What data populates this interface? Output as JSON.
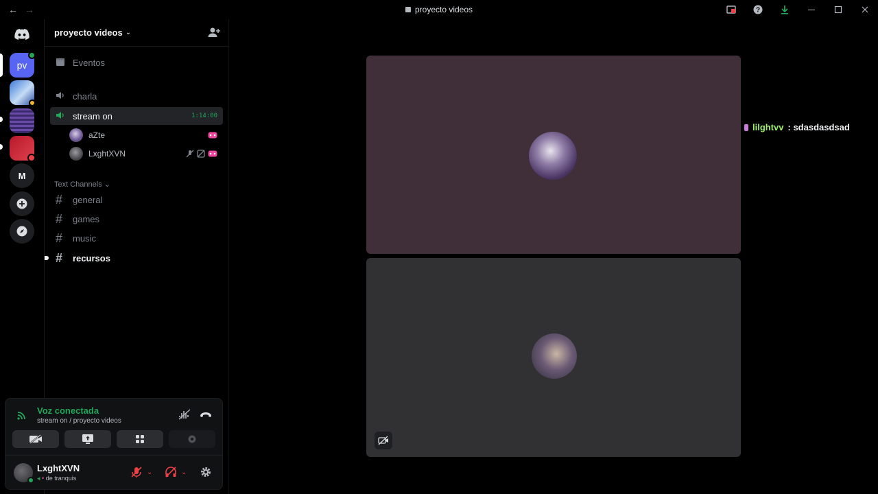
{
  "window": {
    "title": "proyecto videos"
  },
  "server": {
    "name": "proyecto videos",
    "rail_label_pv": "pv",
    "rail_label_m": "M"
  },
  "sidebar": {
    "events_label": "Eventos",
    "voice_channels": [
      {
        "name": "charla"
      },
      {
        "name": "stream on",
        "timer": "1:14:00"
      }
    ],
    "members": [
      {
        "name": "aZte"
      },
      {
        "name": "LxghtXVN"
      }
    ],
    "category": "Text Channels",
    "text_channels": [
      "general",
      "games",
      "music",
      "recursos"
    ]
  },
  "voice": {
    "status": "Voz conectada",
    "location": "stream on / proyecto videos"
  },
  "user": {
    "name": "LxghtXVN",
    "status_text": "de tranquis"
  },
  "overlay": {
    "name": "lilghtvv",
    "text": ": sdasdasdsad"
  },
  "colors": {
    "accent_green": "#23a55a",
    "tile1": "#402e39",
    "tile2": "#313033",
    "blurple": "#5865f2"
  }
}
